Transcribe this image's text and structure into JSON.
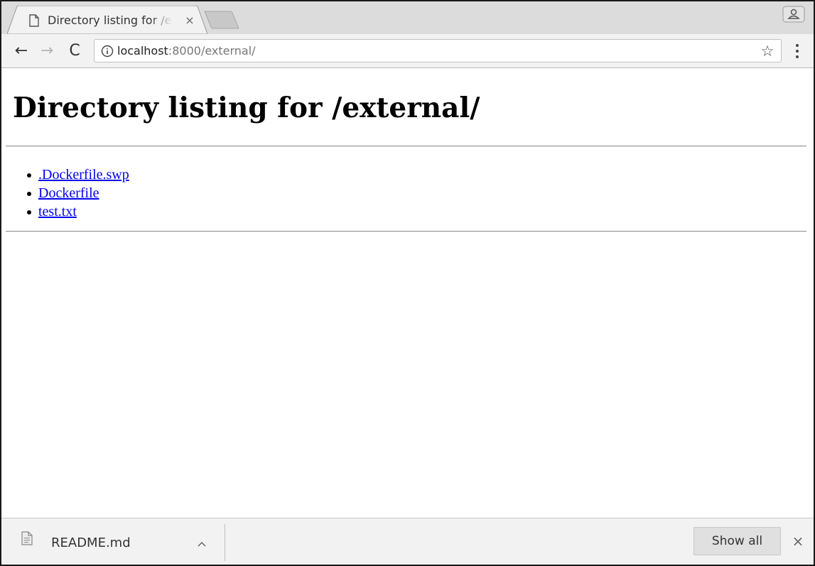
{
  "tab": {
    "title": "Directory listing for /external/",
    "close_symbol": "×",
    "favicon": "page-icon"
  },
  "toolbar": {
    "back_symbol": "←",
    "forward_symbol": "→",
    "reload_symbol": "C",
    "url_host": "localhost",
    "url_rest": ":8000/external/",
    "bookmark_symbol": "☆"
  },
  "page": {
    "heading": "Directory listing for /external/",
    "files": [
      ".Dockerfile.swp",
      "Dockerfile",
      "test.txt"
    ]
  },
  "download_bar": {
    "file_name": "README.md",
    "show_all_label": "Show all",
    "close_symbol": "×"
  },
  "colors": {
    "link": "#0000ee",
    "chrome_bg": "#f2f2f2",
    "tabstrip_bg": "#dcdcdc"
  }
}
